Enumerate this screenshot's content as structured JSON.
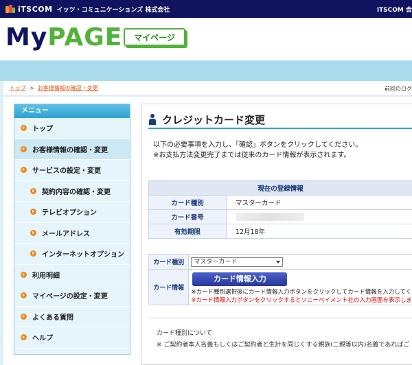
{
  "topbar": {
    "brand": "iTSCOM",
    "company": "イッツ・コミュニケーションズ 株式会社",
    "right": "iTSCOM 会"
  },
  "header": {
    "logo_my": "My",
    "logo_page": "PAGE",
    "badge": "マイページ"
  },
  "breadcrumb": {
    "top": "トップ",
    "sep": ">",
    "current": "お客様情報の確認・変更",
    "prev": "前回のログ"
  },
  "sidebar": {
    "header": "メニュー",
    "items": [
      {
        "label": "トップ"
      },
      {
        "label": "お客様情報の確認・変更"
      },
      {
        "label": "サービスの設定・変更"
      },
      {
        "label": "契約内容の確認・変更"
      },
      {
        "label": "テレビオプション"
      },
      {
        "label": "メールアドレス"
      },
      {
        "label": "インターネットオプション"
      },
      {
        "label": "利用明細"
      },
      {
        "label": "マイページの設定・変更"
      },
      {
        "label": "よくある質問"
      },
      {
        "label": "ヘルプ"
      }
    ]
  },
  "main": {
    "title": "クレジットカード変更",
    "intro_line1": "以下の必要事項を入力し、「確認」ボタンをクリックしてください。",
    "intro_line2": "※お支払方法変更完了までは従来のカード情報が表示されます。",
    "current": {
      "caption": "現在の登録情報",
      "rows": [
        {
          "label": "カード種別",
          "value": "マスターカード"
        },
        {
          "label": "カード番号",
          "value": ""
        },
        {
          "label": "有効期限",
          "value": "12月18年"
        }
      ]
    },
    "form": {
      "type_label": "カード種別",
      "type_selected": "マスターカード",
      "info_label": "カード情報",
      "button": "カード情報入力",
      "note1": "※カード種別選択後にカード情報入力ボタンをクリックしてカード情報を入力してく",
      "note2": "※カード情報入力ボタンをクリックするとソニーペイメント社の入力画面を表示しま"
    },
    "footnote_line1": "カード種別について",
    "footnote_line2": "※ ご契約者本人名義もしくはご契約者と生計を同じくする親族(二親等以内)名義であればご"
  }
}
